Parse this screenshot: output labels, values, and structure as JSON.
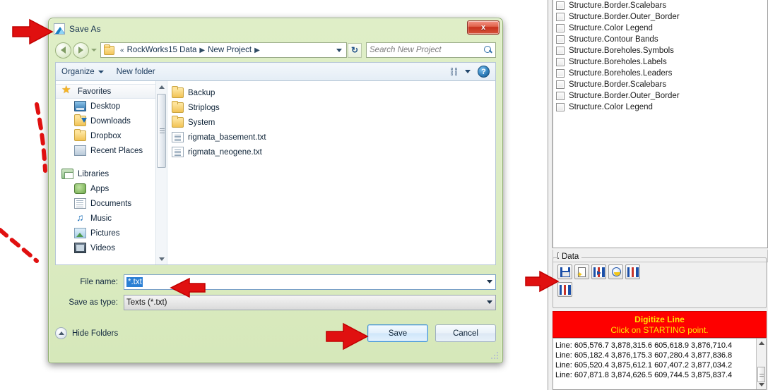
{
  "dialog": {
    "title": "Save As",
    "close_label": "x",
    "address": {
      "crumb_root": "RockWorks15 Data",
      "crumb_child": "New Project",
      "double_chevron": "«",
      "separator": "▶",
      "refresh_label": "↻"
    },
    "search": {
      "placeholder": "Search New Project",
      "icon": "search-icon"
    },
    "commandbar": {
      "organize": "Organize",
      "new_folder": "New folder",
      "help": "?"
    },
    "nav_pane": {
      "items": [
        {
          "label": "Favorites",
          "icon": "star-icon",
          "level": "head"
        },
        {
          "label": "Desktop",
          "icon": "desktop-icon",
          "level": "child"
        },
        {
          "label": "Downloads",
          "icon": "downloads-icon",
          "level": "child"
        },
        {
          "label": "Dropbox",
          "icon": "folder-icon",
          "level": "child"
        },
        {
          "label": "Recent Places",
          "icon": "recent-places-icon",
          "level": "child"
        },
        {
          "label": "Libraries",
          "icon": "libraries-icon",
          "level": "head"
        },
        {
          "label": "Apps",
          "icon": "apps-icon",
          "level": "child"
        },
        {
          "label": "Documents",
          "icon": "documents-icon",
          "level": "child"
        },
        {
          "label": "Music",
          "icon": "music-icon",
          "level": "child"
        },
        {
          "label": "Pictures",
          "icon": "pictures-icon",
          "level": "child"
        },
        {
          "label": "Videos",
          "icon": "videos-icon",
          "level": "child"
        }
      ]
    },
    "file_list": [
      {
        "name": "Backup",
        "type": "folder"
      },
      {
        "name": "Striplogs",
        "type": "folder"
      },
      {
        "name": "System",
        "type": "folder"
      },
      {
        "name": "rigmata_basement.txt",
        "type": "text"
      },
      {
        "name": "rigmata_neogene.txt",
        "type": "text"
      }
    ],
    "form": {
      "file_name_label": "File name:",
      "file_name_value": "*.txt",
      "save_as_type_label": "Save as type:",
      "save_as_type_value": "Texts (*.txt)"
    },
    "buttons": {
      "hide_folders": "Hide Folders",
      "save": "Save",
      "cancel": "Cancel"
    }
  },
  "right_panel": {
    "layer_list": [
      "Structure.Border.Scalebars",
      "Structure.Border.Outer_Border",
      "Structure.Color Legend",
      "Structure.Contour Bands",
      "Structure.Boreholes.Symbols",
      "Structure.Boreholes.Labels",
      "Structure.Boreholes.Leaders",
      "Structure.Border.Scalebars",
      "Structure.Border.Outer_Border",
      "Structure.Color Legend"
    ],
    "data_group": {
      "title": "Data",
      "tools": [
        {
          "name": "save-data-icon"
        },
        {
          "name": "new-document-icon"
        },
        {
          "name": "import-panel-icon"
        },
        {
          "name": "globe-panel-icon"
        },
        {
          "name": "export-panel-icon"
        },
        {
          "name": "mirror-panel-icon"
        }
      ]
    },
    "digitize": {
      "title": "Digitize Line",
      "instruction": "Click on STARTING point."
    },
    "coordinates": [
      "Line: 605,576.7 3,878,315.6 605,618.9 3,876,710.4",
      "Line: 605,182.4 3,876,175.3 607,280.4 3,877,836.8",
      "Line: 605,520.4 3,875,612.1 607,407.2 3,877,034.2",
      "Line: 607,871.8 3,874,626.5 609,744.5 3,875,837.4"
    ]
  },
  "annotations": {
    "arrow_title": "arrow-pointing-to-title",
    "arrow_filename": "arrow-pointing-to-file-name",
    "arrow_save": "arrow-pointing-to-save-button",
    "arrow_save_data": "arrow-pointing-to-save-data-icon",
    "dashed_line": "red-dashed-connector",
    "color": "#e01010"
  }
}
